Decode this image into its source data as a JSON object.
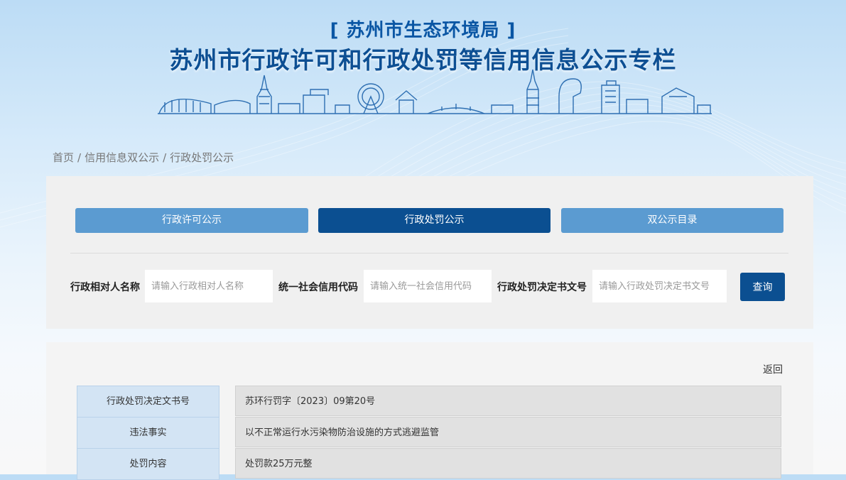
{
  "header": {
    "subtitle": "[ 苏州市生态环境局 ]",
    "title": "苏州市行政许可和行政处罚等信用信息公示专栏"
  },
  "breadcrumb": [
    "首页",
    "信用信息双公示",
    "行政处罚公示"
  ],
  "breadcrumb_separator": "/",
  "tabs": [
    {
      "label": "行政许可公示",
      "active": false
    },
    {
      "label": "行政处罚公示",
      "active": true
    },
    {
      "label": "双公示目录",
      "active": false
    }
  ],
  "search": {
    "name_label": "行政相对人名称",
    "name_placeholder": "请输入行政相对人名称",
    "code_label": "统一社会信用代码",
    "code_placeholder": "请输入统一社会信用代码",
    "doc_label": "行政处罚决定书文号",
    "doc_placeholder": "请输入行政处罚决定书文号",
    "query_button": "查询"
  },
  "detail": {
    "back": "返回",
    "rows": [
      {
        "label": "行政处罚决定文书号",
        "value": "苏环行罚字〔2023〕09第20号"
      },
      {
        "label": "违法事实",
        "value": "以不正常运行水污染物防治设施的方式逃避监管"
      },
      {
        "label": "处罚内容",
        "value": "处罚款25万元整"
      }
    ]
  },
  "colors": {
    "primary": "#0b4f91",
    "tab_inactive": "#5b9bd1",
    "label_cell": "#d3e4f4",
    "value_cell": "#e1e1e1",
    "title": "#0d4f93"
  }
}
